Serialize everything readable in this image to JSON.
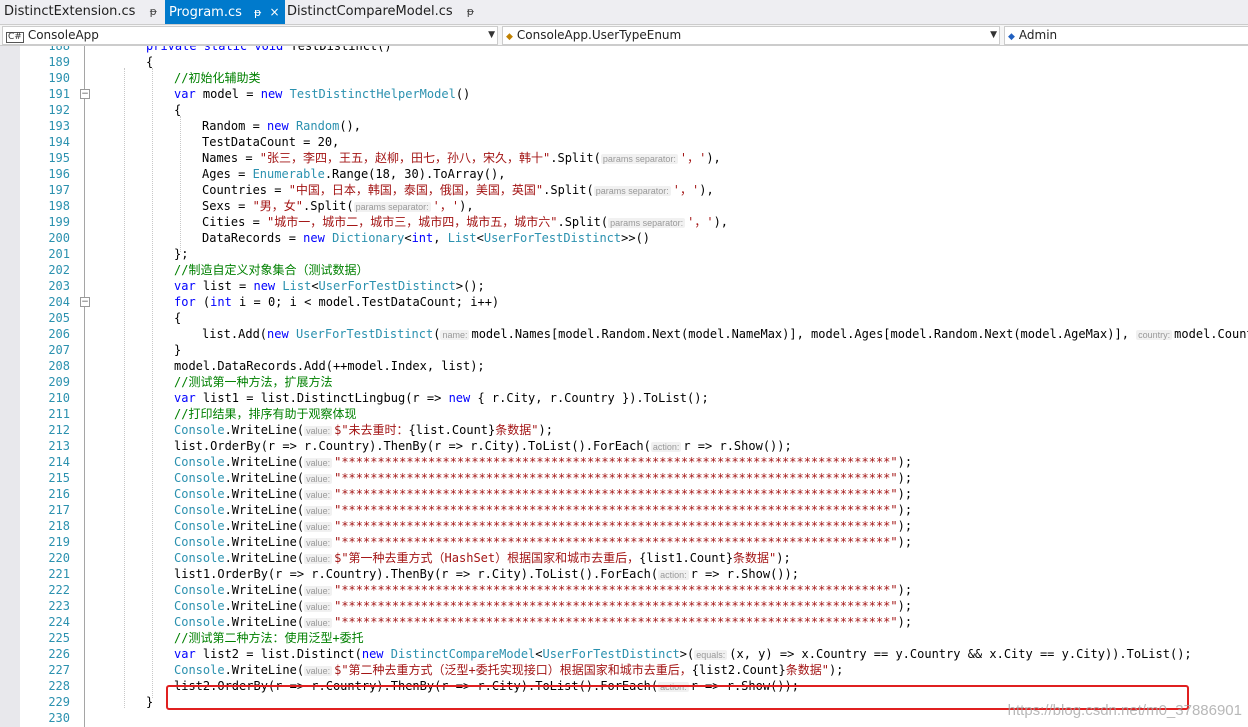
{
  "tabs": [
    {
      "label": "DistinctExtension.cs",
      "pin": "ᵽ",
      "active": false
    },
    {
      "label": "Program.cs",
      "pin": "ᵽ",
      "active": true,
      "close": "×"
    },
    {
      "label": "DistinctCompareModel.cs",
      "pin": "ᵽ",
      "active": false
    }
  ],
  "nav": {
    "project": "ConsoleApp",
    "type": "ConsoleApp.UserTypeEnum",
    "member": "Admin"
  },
  "editor": {
    "partial_top_line": "private static void TestDistinct()",
    "line_numbers": [
      "189",
      "190",
      "191",
      "192",
      "193",
      "194",
      "195",
      "196",
      "197",
      "198",
      "199",
      "200",
      "201",
      "202",
      "203",
      "204",
      "205",
      "206",
      "207",
      "208",
      "209",
      "210",
      "211",
      "212",
      "213",
      "214",
      "215",
      "216",
      "217",
      "218",
      "219",
      "220",
      "221",
      "222",
      "223",
      "224",
      "225",
      "226",
      "227",
      "228",
      "229",
      "230"
    ],
    "hint_value": "value:",
    "hint_action": "action:",
    "hint_params": "params separator:",
    "hint_name": "name:",
    "hint_country": "country:",
    "hint_equals": "equals:",
    "stars": "\"****************************************************************************\""
  },
  "watermark": "https://blog.csdn.net/m0_37886901"
}
